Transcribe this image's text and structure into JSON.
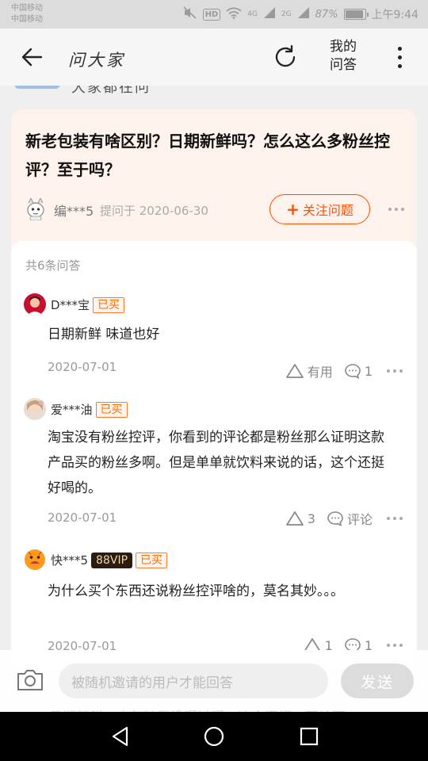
{
  "status_bar": {
    "carrier1": "中国移动",
    "carrier2": "中国移动",
    "net1": "4G",
    "net2": "2G",
    "battery": "87%",
    "battery_level": 0.87,
    "time": "上午9:44"
  },
  "header": {
    "title": "问大家",
    "my_answers_line1": "我的",
    "my_answers_line2": "问答"
  },
  "cut_strip": {
    "text": "大家都在问"
  },
  "question": {
    "title": "新老包装有啥区别？日期新鲜吗？怎么这么多粉丝控评？至于吗？",
    "asker": "编***5",
    "asked_on": "提问于 2020-06-30",
    "follow_label": "关注问题"
  },
  "answers_header": {
    "count_label": "共6条问答"
  },
  "answers": [
    {
      "user": "D***宝",
      "badge_bought": "已买",
      "badge_vip": "",
      "text": "日期新鲜 味道也好",
      "date": "2020-07-01",
      "like_label": "有用",
      "comment_label": "1"
    },
    {
      "user": "爱***油",
      "badge_bought": "已买",
      "badge_vip": "",
      "text": "淘宝没有粉丝控评，你看到的评论都是粉丝那么证明这款产品买的粉丝多啊。但是单单就饮料来说的话，这个还挺好喝的。",
      "date": "2020-07-01",
      "like_label": "3",
      "comment_label": "评论"
    },
    {
      "user": "快***5",
      "badge_bought": "已买",
      "badge_vip": "88VIP",
      "text": "为什么买个东西还说粉丝控评啥的，莫名其妙。。。",
      "date": "2020-07-01",
      "like_label": "1",
      "comment_label": "1"
    }
  ],
  "bottom_bar": {
    "input_placeholder": "被随机邀请的用户才能回答",
    "send_label": "发送",
    "behind_text": "日期新鲜，本包装我没喝过呀，这个还行，可给不"
  },
  "colors": {
    "accent": "#ff5000",
    "card_tint": "#fdf2ec"
  },
  "icons": [
    "back-arrow-icon",
    "refresh-icon",
    "more-vertical-icon",
    "warning-triangle-icon",
    "comment-bubble-icon",
    "camera-icon",
    "nav-back-icon",
    "nav-home-icon",
    "nav-recents-icon"
  ]
}
